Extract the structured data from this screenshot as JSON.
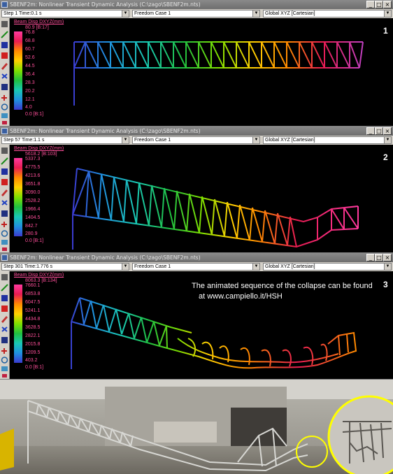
{
  "colors": {
    "scale_top": "#ff3aa0",
    "scale_bottom": "#3b3bd0",
    "highlight_circle": "#ffff00"
  },
  "panels": [
    {
      "title": "SBENF2m: Nonlinear Transient Dynamic Analysis (C:\\zago\\SBENF2m.nts)",
      "step": "Step 1 Time:0.1 s",
      "case": "Freedom Case 1",
      "frame": "Global XYZ [Cartesian]",
      "legend_title": "Beam Disp DXYZ(mm)",
      "legend_max": "80.9 [B:17]",
      "legend_values": [
        "76.8",
        "68.8",
        "60.7",
        "52.6",
        "44.5",
        "36.4",
        "28.3",
        "20.2",
        "12.1",
        "4.0"
      ],
      "legend_min": "0.0 [B:1]",
      "number": "1"
    },
    {
      "title": "SBENF2m: Nonlinear Transient Dynamic Analysis (C:\\zago\\SBENF2m.nts)",
      "step": "Step 57 Time:1.1 s",
      "case": "Freedom Case 1",
      "frame": "Global XYZ [Cartesian]",
      "legend_title": "Beam Disp DXYZ(mm)",
      "legend_max": "5618.2 [B:103]",
      "legend_values": [
        "5337.3",
        "4775.5",
        "4213.6",
        "3651.8",
        "3090.0",
        "2528.2",
        "1966.4",
        "1404.5",
        "842.7",
        "280.9"
      ],
      "legend_min": "0.0 [B:1]",
      "number": "2"
    },
    {
      "title": "SBENF2m: Nonlinear Transient Dynamic Analysis (C:\\zago\\SBENF2m.nts)",
      "step": "Step 301 Time:1.776 s",
      "case": "Freedom Case 1",
      "frame": "Global XYZ [Cartesian]",
      "legend_title": "Beam Disp DXYZ(mm)",
      "legend_max": "8063.3 [B:134]",
      "legend_values": [
        "7660.1",
        "6853.8",
        "6047.5",
        "5241.1",
        "4434.8",
        "3628.5",
        "2822.1",
        "2015.8",
        "1209.5",
        "403.2"
      ],
      "legend_min": "0.0 [B:1]",
      "number": "3",
      "note_line1": "The animated sequence of the collapse can be found",
      "note_line2": "at  www.campiello.it/HSH"
    }
  ],
  "window_buttons": [
    "_",
    "□",
    "×"
  ]
}
